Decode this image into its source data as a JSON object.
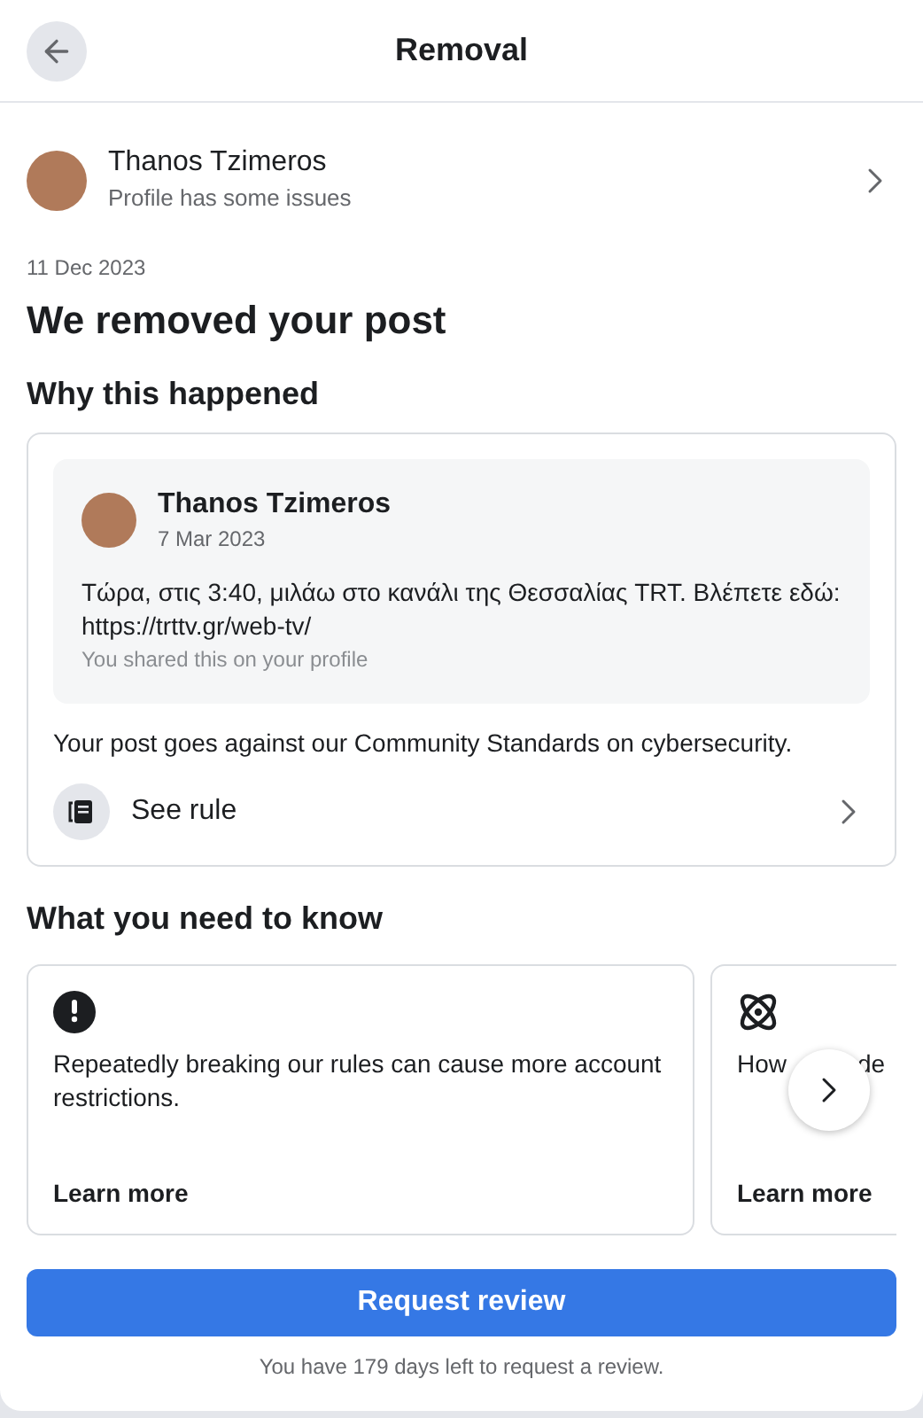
{
  "header": {
    "title": "Removal"
  },
  "profile": {
    "name": "Thanos Tzimeros",
    "status": "Profile has some issues"
  },
  "date": "11 Dec 2023",
  "headline": "We removed your post",
  "why": {
    "heading": "Why this happened",
    "post": {
      "author": "Thanos Tzimeros",
      "date": "7 Mar 2023",
      "text": "Τώρα, στις 3:40, μιλάω στο κανάλι της Θεσσαλίας TRT. Βλέπετε εδώ: https://trttv.gr/web-tv/",
      "note": "You shared this on your profile"
    },
    "reason": "Your post goes against our Community Standards on cybersecurity.",
    "rule_link": "See rule"
  },
  "know": {
    "heading": "What you need to know",
    "cards": [
      {
        "kind": "alert",
        "text_parts": [
          "Repeatedly breaking our rules can cause more account restrictions."
        ],
        "link": "Learn more"
      },
      {
        "kind": "atom",
        "text_parts": [
          "How",
          "de"
        ],
        "link": "Learn more"
      }
    ]
  },
  "action": {
    "button": "Request review",
    "note": "You have 179 days left to request a review."
  }
}
